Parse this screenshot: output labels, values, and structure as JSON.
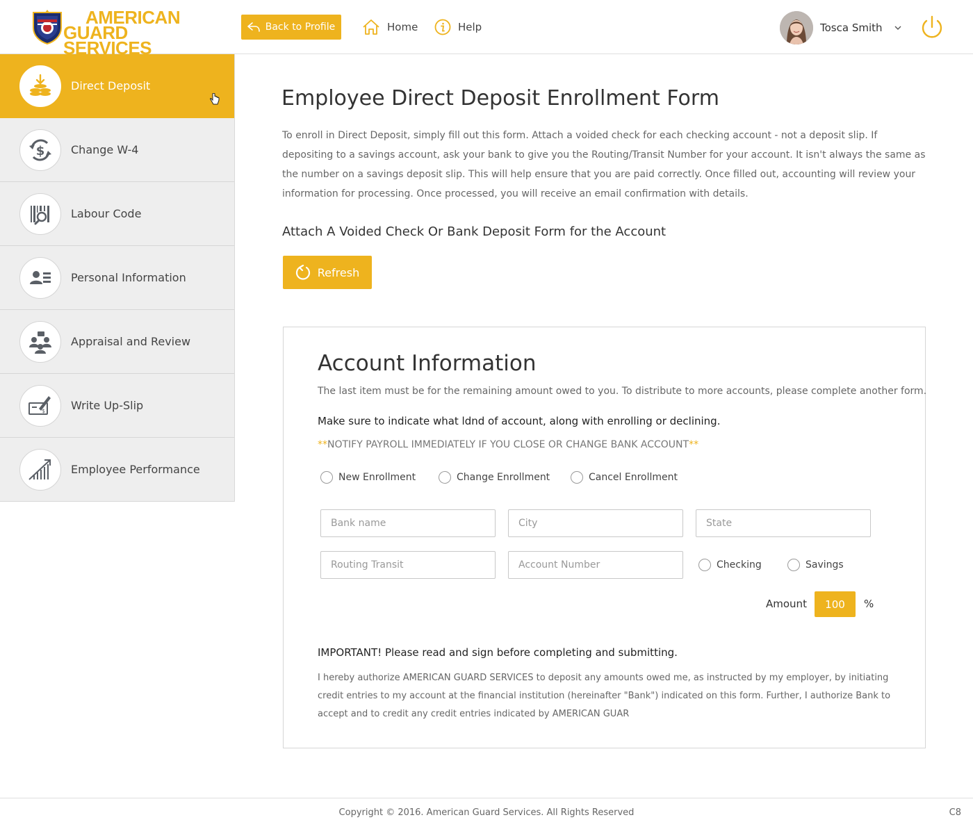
{
  "header": {
    "logo_line1": "AMERICAN",
    "logo_line2": "GUARD SERVICES",
    "back_label": "Back to Profile",
    "home_label": "Home",
    "help_label": "Help",
    "user_name": "Tosca Smith"
  },
  "sidebar": {
    "items": [
      {
        "label": "Direct Deposit",
        "icon": "coins-deposit-icon",
        "active": true
      },
      {
        "label": "Change W-4",
        "icon": "dollar-cycle-icon"
      },
      {
        "label": "Labour Code",
        "icon": "barcode-search-icon"
      },
      {
        "label": "Personal Information",
        "icon": "id-card-icon"
      },
      {
        "label": "Appraisal and Review",
        "icon": "people-review-icon"
      },
      {
        "label": "Write Up-Slip",
        "icon": "check-sign-icon"
      },
      {
        "label": "Employee Performance",
        "icon": "growth-chart-icon"
      }
    ]
  },
  "main": {
    "title": "Employee Direct Deposit Enrollment Form",
    "intro": "To enroll in Direct Deposit, simply fill out this form. Attach a voided check for each checking account - not a deposit slip. If depositing to a savings account, ask your bank to give you the Routing/Transit Number for your account. It isn't always the same as the number on a savings deposit slip. This will help ensure that you are paid correctly. Once filled out, accounting will review your information for processing. Once processed, you will receive an email confirmation with details.",
    "attach_heading": "Attach A Voided Check Or Bank Deposit Form for the Account",
    "refresh_label": "Refresh"
  },
  "account": {
    "title": "Account Information",
    "subtitle": "The last item must be for the remaining amount owed to you. To distribute to more accounts, please complete another form.",
    "make_sure": "Make sure to indicate what ldnd of account, along with enrolling or declining.",
    "notify_stars": "**",
    "notify_text": "NOTIFY PAYROLL IMMEDIATELY IF YOU CLOSE OR CHANGE BANK ACCOUNT",
    "enrollment_options": [
      "New Enrollment",
      "Change Enrollment",
      "Cancel Enrollment"
    ],
    "placeholders": {
      "bank_name": "Bank name",
      "city": "City",
      "state": "State",
      "routing": "Routing Transit",
      "account_number": "Account Number"
    },
    "account_types": [
      "Checking",
      "Savings"
    ],
    "amount_label": "Amount",
    "amount_value": "100",
    "amount_unit": "%",
    "important": "IMPORTANT! Please read and sign before completing and submitting.",
    "authorize": "I hereby authorize AMERICAN GUARD SERVICES to deposit any amounts owed me, as instructed by my employer, by initiating credit entries to my account at the financial institution (hereinafter \"Bank\") indicated on this form. Further, I authorize Bank to accept and to credit any credit entries indicated by AMERICAN GUAR"
  },
  "footer": {
    "copyright": "Copyright © 2016. American Guard Services. All Rights Reserved",
    "corner": "C8"
  },
  "colors": {
    "accent": "#eeb31e",
    "sidebar_bg": "#eeeeee",
    "icon_gray": "#5a5f66"
  }
}
